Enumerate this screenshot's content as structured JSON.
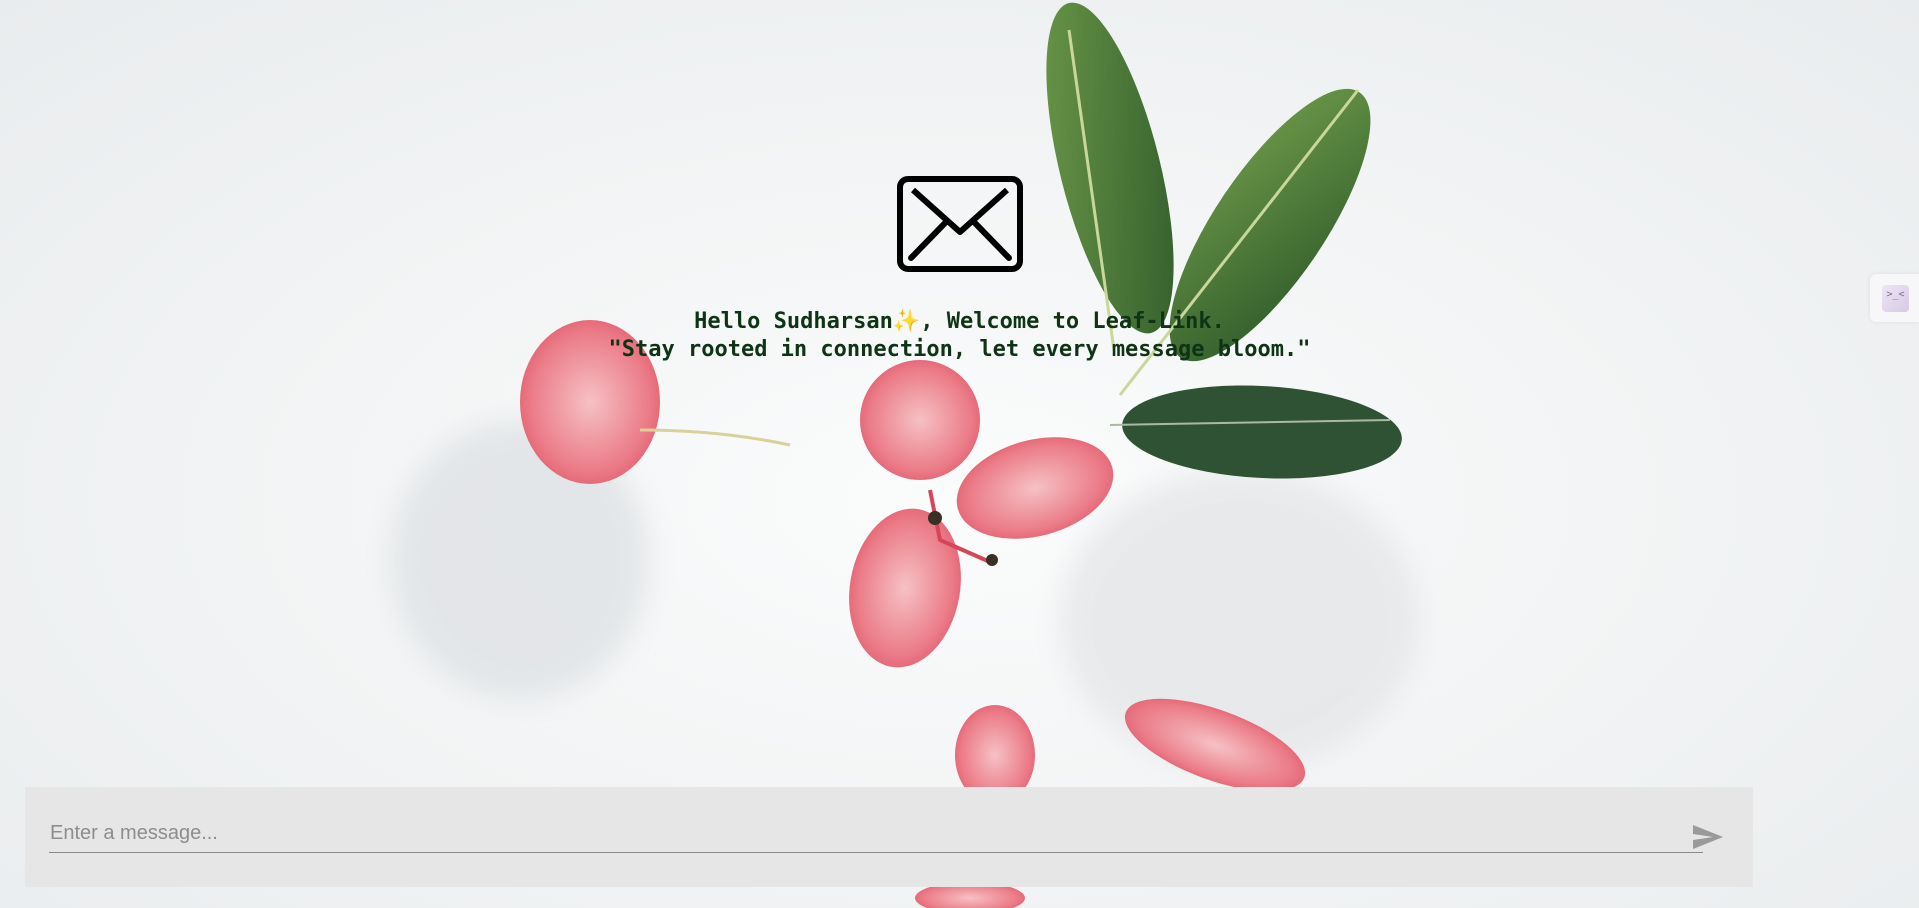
{
  "welcome": {
    "line1": "Hello Sudharsan✨, Welcome to Leaf-Link.",
    "line2": "\"Stay rooted in connection, let every message bloom.\""
  },
  "composer": {
    "placeholder": "Enter a message...",
    "value": ""
  },
  "side_widget": {
    "face": ">_<"
  },
  "icons": {
    "envelope": "envelope-icon",
    "send": "send-icon"
  },
  "colors": {
    "welcome_text": "#0f3315",
    "composer_bg": "#e6e6e7",
    "send_icon": "#9a9a9a"
  }
}
